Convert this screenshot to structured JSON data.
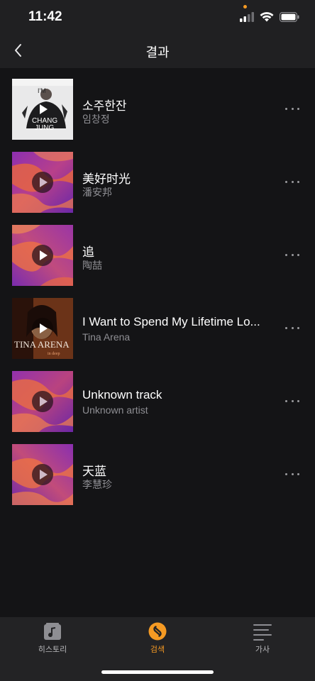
{
  "status_bar": {
    "time": "11:42"
  },
  "nav": {
    "title": "결과"
  },
  "tracks": [
    {
      "title": "소주한잔",
      "artist": "임창정",
      "art": "photo-chang"
    },
    {
      "title": "美好时光",
      "artist": "潘安邦",
      "art": "gradient"
    },
    {
      "title": "追",
      "artist": "陶喆",
      "art": "gradient"
    },
    {
      "title": "I Want to Spend My Lifetime Lo...",
      "artist": "Tina Arena",
      "art": "photo-tina"
    },
    {
      "title": "Unknown track",
      "artist": "Unknown artist",
      "art": "gradient"
    },
    {
      "title": "天蓝",
      "artist": "李慧珍",
      "art": "gradient"
    }
  ],
  "tabs": [
    {
      "label": "히스토리",
      "icon": "music-note-icon",
      "active": false
    },
    {
      "label": "검색",
      "icon": "shazam-icon",
      "active": true
    },
    {
      "label": "가사",
      "icon": "lyrics-icon",
      "active": false
    }
  ],
  "colors": {
    "accent": "#f59a23",
    "background": "#141416",
    "bar": "#202022"
  }
}
